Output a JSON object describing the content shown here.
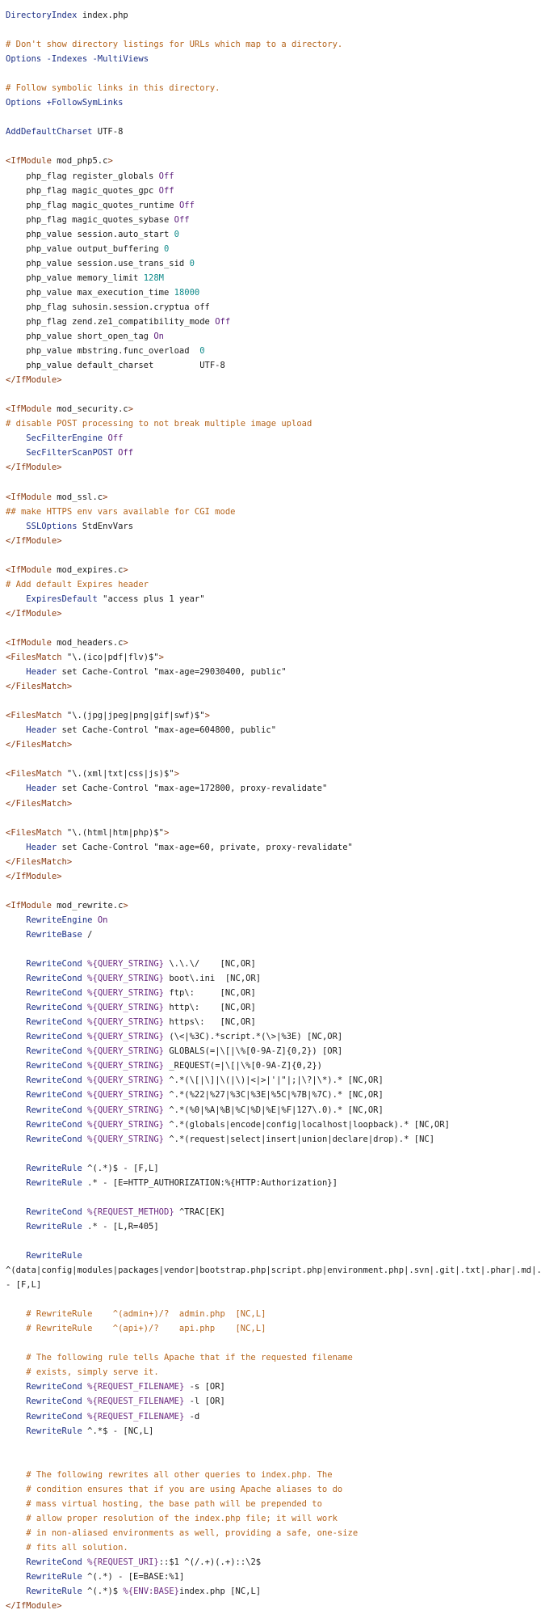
{
  "lines": [
    [
      [
        "directive",
        "DirectoryIndex"
      ],
      [
        "text",
        " index.php"
      ]
    ],
    [],
    [
      [
        "comment",
        "# Don't show directory listings for URLs which map to a directory."
      ]
    ],
    [
      [
        "directive",
        "Options"
      ],
      [
        "text",
        " "
      ],
      [
        "directive",
        "-Indexes -MultiViews"
      ]
    ],
    [],
    [
      [
        "comment",
        "# Follow symbolic links in this directory."
      ]
    ],
    [
      [
        "directive",
        "Options"
      ],
      [
        "text",
        " "
      ],
      [
        "directive",
        "+FollowSymLinks"
      ]
    ],
    [],
    [
      [
        "directive",
        "AddDefaultCharset"
      ],
      [
        "text",
        " UTF-8"
      ]
    ],
    [],
    [
      [
        "tag",
        "<IfModule"
      ],
      [
        "text",
        " mod_php5.c"
      ],
      [
        "tag",
        ">"
      ]
    ],
    [
      [
        "text",
        "    php_flag register_globals "
      ],
      [
        "keyword",
        "Off"
      ]
    ],
    [
      [
        "text",
        "    php_flag magic_quotes_gpc "
      ],
      [
        "keyword",
        "Off"
      ]
    ],
    [
      [
        "text",
        "    php_flag magic_quotes_runtime "
      ],
      [
        "keyword",
        "Off"
      ]
    ],
    [
      [
        "text",
        "    php_flag magic_quotes_sybase "
      ],
      [
        "keyword",
        "Off"
      ]
    ],
    [
      [
        "text",
        "    php_value session.auto_start "
      ],
      [
        "number",
        "0"
      ]
    ],
    [
      [
        "text",
        "    php_value output_buffering "
      ],
      [
        "number",
        "0"
      ]
    ],
    [
      [
        "text",
        "    php_value session.use_trans_sid "
      ],
      [
        "number",
        "0"
      ]
    ],
    [
      [
        "text",
        "    php_value memory_limit "
      ],
      [
        "number",
        "128M"
      ]
    ],
    [
      [
        "text",
        "    php_value max_execution_time "
      ],
      [
        "number",
        "18000"
      ]
    ],
    [
      [
        "text",
        "    php_flag suhosin.session.cryptua off"
      ]
    ],
    [
      [
        "text",
        "    php_flag zend.ze1_compatibility_mode "
      ],
      [
        "keyword",
        "Off"
      ]
    ],
    [
      [
        "text",
        "    php_value short_open_tag "
      ],
      [
        "keyword",
        "On"
      ]
    ],
    [
      [
        "text",
        "    php_value mbstring.func_overload  "
      ],
      [
        "number",
        "0"
      ]
    ],
    [
      [
        "text",
        "    php_value default_charset         UTF-8"
      ]
    ],
    [
      [
        "tag",
        "</IfModule>"
      ]
    ],
    [],
    [
      [
        "tag",
        "<IfModule"
      ],
      [
        "text",
        " mod_security.c"
      ],
      [
        "tag",
        ">"
      ]
    ],
    [
      [
        "comment",
        "# disable POST processing to not break multiple image upload"
      ]
    ],
    [
      [
        "text",
        "    "
      ],
      [
        "directive",
        "SecFilterEngine"
      ],
      [
        "text",
        " "
      ],
      [
        "keyword",
        "Off"
      ]
    ],
    [
      [
        "text",
        "    "
      ],
      [
        "directive",
        "SecFilterScanPOST"
      ],
      [
        "text",
        " "
      ],
      [
        "keyword",
        "Off"
      ]
    ],
    [
      [
        "tag",
        "</IfModule>"
      ]
    ],
    [],
    [
      [
        "tag",
        "<IfModule"
      ],
      [
        "text",
        " mod_ssl.c"
      ],
      [
        "tag",
        ">"
      ]
    ],
    [
      [
        "comment",
        "## make HTTPS env vars available for CGI mode"
      ]
    ],
    [
      [
        "text",
        "    "
      ],
      [
        "directive",
        "SSLOptions"
      ],
      [
        "text",
        " StdEnvVars"
      ]
    ],
    [
      [
        "tag",
        "</IfModule>"
      ]
    ],
    [],
    [
      [
        "tag",
        "<IfModule"
      ],
      [
        "text",
        " mod_expires.c"
      ],
      [
        "tag",
        ">"
      ]
    ],
    [
      [
        "comment",
        "# Add default Expires header"
      ]
    ],
    [
      [
        "text",
        "    "
      ],
      [
        "directive",
        "ExpiresDefault"
      ],
      [
        "text",
        " \"access plus 1 year\""
      ]
    ],
    [
      [
        "tag",
        "</IfModule>"
      ]
    ],
    [],
    [
      [
        "tag",
        "<IfModule"
      ],
      [
        "text",
        " mod_headers.c"
      ],
      [
        "tag",
        ">"
      ]
    ],
    [
      [
        "tag",
        "<FilesMatch"
      ],
      [
        "text",
        " \"\\.(ico|pdf|flv)$\""
      ],
      [
        "tag",
        ">"
      ]
    ],
    [
      [
        "text",
        "    "
      ],
      [
        "directive",
        "Header"
      ],
      [
        "text",
        " set Cache-Control \"max-age=29030400, public\""
      ]
    ],
    [
      [
        "tag",
        "</FilesMatch>"
      ]
    ],
    [],
    [
      [
        "tag",
        "<FilesMatch"
      ],
      [
        "text",
        " \"\\.(jpg|jpeg|png|gif|swf)$\""
      ],
      [
        "tag",
        ">"
      ]
    ],
    [
      [
        "text",
        "    "
      ],
      [
        "directive",
        "Header"
      ],
      [
        "text",
        " set Cache-Control \"max-age=604800, public\""
      ]
    ],
    [
      [
        "tag",
        "</FilesMatch>"
      ]
    ],
    [],
    [
      [
        "tag",
        "<FilesMatch"
      ],
      [
        "text",
        " \"\\.(xml|txt|css|js)$\""
      ],
      [
        "tag",
        ">"
      ]
    ],
    [
      [
        "text",
        "    "
      ],
      [
        "directive",
        "Header"
      ],
      [
        "text",
        " set Cache-Control \"max-age=172800, proxy-revalidate\""
      ]
    ],
    [
      [
        "tag",
        "</FilesMatch>"
      ]
    ],
    [],
    [
      [
        "tag",
        "<FilesMatch"
      ],
      [
        "text",
        " \"\\.(html|htm|php)$\""
      ],
      [
        "tag",
        ">"
      ]
    ],
    [
      [
        "text",
        "    "
      ],
      [
        "directive",
        "Header"
      ],
      [
        "text",
        " set Cache-Control \"max-age=60, private, proxy-revalidate\""
      ]
    ],
    [
      [
        "tag",
        "</FilesMatch>"
      ]
    ],
    [
      [
        "tag",
        "</IfModule>"
      ]
    ],
    [],
    [
      [
        "tag",
        "<IfModule"
      ],
      [
        "text",
        " mod_rewrite.c"
      ],
      [
        "tag",
        ">"
      ]
    ],
    [
      [
        "text",
        "    "
      ],
      [
        "directive",
        "RewriteEngine"
      ],
      [
        "text",
        " "
      ],
      [
        "keyword",
        "On"
      ]
    ],
    [
      [
        "text",
        "    "
      ],
      [
        "directive",
        "RewriteBase"
      ],
      [
        "text",
        " /"
      ]
    ],
    [],
    [
      [
        "text",
        "    "
      ],
      [
        "directive",
        "RewriteCond"
      ],
      [
        "text",
        " "
      ],
      [
        "variable",
        "%{QUERY_STRING}"
      ],
      [
        "text",
        " \\.\\.\\/    [NC,OR]"
      ]
    ],
    [
      [
        "text",
        "    "
      ],
      [
        "directive",
        "RewriteCond"
      ],
      [
        "text",
        " "
      ],
      [
        "variable",
        "%{QUERY_STRING}"
      ],
      [
        "text",
        " boot\\.ini  [NC,OR]"
      ]
    ],
    [
      [
        "text",
        "    "
      ],
      [
        "directive",
        "RewriteCond"
      ],
      [
        "text",
        " "
      ],
      [
        "variable",
        "%{QUERY_STRING}"
      ],
      [
        "text",
        " ftp\\:     [NC,OR]"
      ]
    ],
    [
      [
        "text",
        "    "
      ],
      [
        "directive",
        "RewriteCond"
      ],
      [
        "text",
        " "
      ],
      [
        "variable",
        "%{QUERY_STRING}"
      ],
      [
        "text",
        " http\\:    [NC,OR]"
      ]
    ],
    [
      [
        "text",
        "    "
      ],
      [
        "directive",
        "RewriteCond"
      ],
      [
        "text",
        " "
      ],
      [
        "variable",
        "%{QUERY_STRING}"
      ],
      [
        "text",
        " https\\:   [NC,OR]"
      ]
    ],
    [
      [
        "text",
        "    "
      ],
      [
        "directive",
        "RewriteCond"
      ],
      [
        "text",
        " "
      ],
      [
        "variable",
        "%{QUERY_STRING}"
      ],
      [
        "text",
        " (\\<|%3C).*script.*(\\>|%3E) [NC,OR]"
      ]
    ],
    [
      [
        "text",
        "    "
      ],
      [
        "directive",
        "RewriteCond"
      ],
      [
        "text",
        " "
      ],
      [
        "variable",
        "%{QUERY_STRING}"
      ],
      [
        "text",
        " GLOBALS(=|\\[|\\%[0-9A-Z]{0,2}) [OR]"
      ]
    ],
    [
      [
        "text",
        "    "
      ],
      [
        "directive",
        "RewriteCond"
      ],
      [
        "text",
        " "
      ],
      [
        "variable",
        "%{QUERY_STRING}"
      ],
      [
        "text",
        " _REQUEST(=|\\[|\\%[0-9A-Z]{0,2})"
      ]
    ],
    [
      [
        "text",
        "    "
      ],
      [
        "directive",
        "RewriteCond"
      ],
      [
        "text",
        " "
      ],
      [
        "variable",
        "%{QUERY_STRING}"
      ],
      [
        "text",
        " ^.*(\\[|\\]|\\(|\\)|<|>|'|\"|;|\\?|\\*).* [NC,OR]"
      ]
    ],
    [
      [
        "text",
        "    "
      ],
      [
        "directive",
        "RewriteCond"
      ],
      [
        "text",
        " "
      ],
      [
        "variable",
        "%{QUERY_STRING}"
      ],
      [
        "text",
        " ^.*(%22|%27|%3C|%3E|%5C|%7B|%7C).* [NC,OR]"
      ]
    ],
    [
      [
        "text",
        "    "
      ],
      [
        "directive",
        "RewriteCond"
      ],
      [
        "text",
        " "
      ],
      [
        "variable",
        "%{QUERY_STRING}"
      ],
      [
        "text",
        " ^.*(%0|%A|%B|%C|%D|%E|%F|127\\.0).* [NC,OR]"
      ]
    ],
    [
      [
        "text",
        "    "
      ],
      [
        "directive",
        "RewriteCond"
      ],
      [
        "text",
        " "
      ],
      [
        "variable",
        "%{QUERY_STRING}"
      ],
      [
        "text",
        " ^.*(globals|encode|config|localhost|loopback).* [NC,OR]"
      ]
    ],
    [
      [
        "text",
        "    "
      ],
      [
        "directive",
        "RewriteCond"
      ],
      [
        "text",
        " "
      ],
      [
        "variable",
        "%{QUERY_STRING}"
      ],
      [
        "text",
        " ^.*(request|select|insert|union|declare|drop).* [NC]"
      ]
    ],
    [],
    [
      [
        "text",
        "    "
      ],
      [
        "directive",
        "RewriteRule"
      ],
      [
        "text",
        " ^(.*)$ - [F,L]"
      ]
    ],
    [
      [
        "text",
        "    "
      ],
      [
        "directive",
        "RewriteRule"
      ],
      [
        "text",
        " .* - [E=HTTP_AUTHORIZATION:%{HTTP:Authorization}]"
      ]
    ],
    [],
    [
      [
        "text",
        "    "
      ],
      [
        "directive",
        "RewriteCond"
      ],
      [
        "text",
        " "
      ],
      [
        "variable",
        "%{REQUEST_METHOD}"
      ],
      [
        "text",
        " ^TRAC[EK]"
      ]
    ],
    [
      [
        "text",
        "    "
      ],
      [
        "directive",
        "RewriteRule"
      ],
      [
        "text",
        " .* - [L,R=405]"
      ]
    ],
    [],
    [
      [
        "text",
        "    "
      ],
      [
        "directive",
        "RewriteRule"
      ]
    ],
    [
      [
        "text",
        "^(data|config|modules|packages|vendor|bootstrap.php|script.php|environment.php|.svn|.git|.txt|.phar|.md|.zip)"
      ]
    ],
    [
      [
        "text",
        "- [F,L]"
      ]
    ],
    [],
    [
      [
        "comment",
        "    # RewriteRule    ^(admin+)/?  admin.php  [NC,L]"
      ]
    ],
    [
      [
        "comment",
        "    # RewriteRule    ^(api+)/?    api.php    [NC,L]"
      ]
    ],
    [],
    [
      [
        "comment",
        "    # The following rule tells Apache that if the requested filename"
      ]
    ],
    [
      [
        "comment",
        "    # exists, simply serve it."
      ]
    ],
    [
      [
        "text",
        "    "
      ],
      [
        "directive",
        "RewriteCond"
      ],
      [
        "text",
        " "
      ],
      [
        "variable",
        "%{REQUEST_FILENAME}"
      ],
      [
        "text",
        " -s [OR]"
      ]
    ],
    [
      [
        "text",
        "    "
      ],
      [
        "directive",
        "RewriteCond"
      ],
      [
        "text",
        " "
      ],
      [
        "variable",
        "%{REQUEST_FILENAME}"
      ],
      [
        "text",
        " -l [OR]"
      ]
    ],
    [
      [
        "text",
        "    "
      ],
      [
        "directive",
        "RewriteCond"
      ],
      [
        "text",
        " "
      ],
      [
        "variable",
        "%{REQUEST_FILENAME}"
      ],
      [
        "text",
        " -d"
      ]
    ],
    [
      [
        "text",
        "    "
      ],
      [
        "directive",
        "RewriteRule"
      ],
      [
        "text",
        " ^.*$ - [NC,L]"
      ]
    ],
    [],
    [],
    [
      [
        "comment",
        "    # The following rewrites all other queries to index.php. The"
      ]
    ],
    [
      [
        "comment",
        "    # condition ensures that if you are using Apache aliases to do"
      ]
    ],
    [
      [
        "comment",
        "    # mass virtual hosting, the base path will be prepended to"
      ]
    ],
    [
      [
        "comment",
        "    # allow proper resolution of the index.php file; it will work"
      ]
    ],
    [
      [
        "comment",
        "    # in non-aliased environments as well, providing a safe, one-size"
      ]
    ],
    [
      [
        "comment",
        "    # fits all solution."
      ]
    ],
    [
      [
        "text",
        "    "
      ],
      [
        "directive",
        "RewriteCond"
      ],
      [
        "text",
        " "
      ],
      [
        "variable",
        "%{REQUEST_URI}"
      ],
      [
        "text",
        "::$1 ^(/.+)(.+)::\\2$"
      ]
    ],
    [
      [
        "text",
        "    "
      ],
      [
        "directive",
        "RewriteRule"
      ],
      [
        "text",
        " ^(.*) - [E=BASE:%1]"
      ]
    ],
    [
      [
        "text",
        "    "
      ],
      [
        "directive",
        "RewriteRule"
      ],
      [
        "text",
        " ^(.*)$ "
      ],
      [
        "variable",
        "%{ENV:BASE}"
      ],
      [
        "text",
        "index.php [NC,L]"
      ]
    ],
    [
      [
        "tag",
        "</IfModule>"
      ]
    ]
  ]
}
